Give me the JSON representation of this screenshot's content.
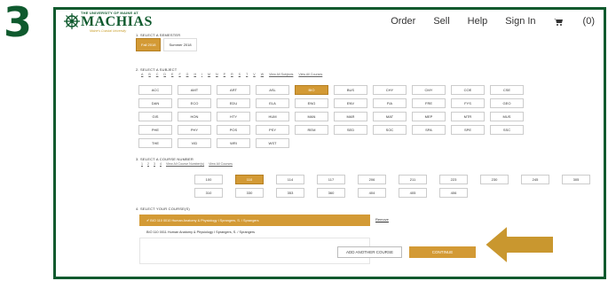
{
  "step_number": "3",
  "header": {
    "logo_top": "THE UNIVERSITY OF MAINE AT",
    "logo_main": "MACHIAS",
    "logo_sub": "Maine's Coastal University",
    "nav": [
      "Order",
      "Sell",
      "Help",
      "Sign In"
    ],
    "cart_count": "(0)"
  },
  "semester": {
    "label": "1. SELECT A SEMESTER",
    "options": [
      {
        "label": "Fall 2018",
        "active": true
      },
      {
        "label": "Summer 2018",
        "active": false
      }
    ]
  },
  "subject": {
    "label": "2. SELECT A SUBJECT",
    "letters": [
      "A",
      "B",
      "C",
      "D",
      "E",
      "F",
      "G",
      "H",
      "I",
      "M",
      "N",
      "P",
      "R",
      "S",
      "T",
      "V",
      "W"
    ],
    "view_all_subjects": "View All Subjects",
    "view_all_courses": "View All Courses",
    "items": [
      "ACC",
      "AMT",
      "ART",
      "ASL",
      "BIO",
      "BUS",
      "CHY",
      "CMY",
      "COE",
      "CSE",
      "DAN",
      "ECO",
      "EDU",
      "ELA",
      "ENG",
      "ENV",
      "FIA",
      "FRE",
      "FYS",
      "GEO",
      "GIS",
      "HON",
      "HTY",
      "HUM",
      "MAN",
      "MAR",
      "MAT",
      "MEP",
      "MTR",
      "MUS",
      "PHE",
      "PHY",
      "POS",
      "PSY",
      "REM",
      "SED",
      "SOC",
      "SPA",
      "SPE",
      "SSC",
      "THE",
      "VID",
      "WRI",
      "WST"
    ],
    "active": "BIO"
  },
  "course_number": {
    "label": "3. SELECT A COURSE NUMBER",
    "digits": [
      "1",
      "2",
      "3",
      "4"
    ],
    "view_all_numbers": "View All Course Number(s)",
    "view_all_courses": "View All Courses",
    "items": [
      "100",
      "110",
      "114",
      "117",
      "206",
      "211",
      "223",
      "230",
      "245",
      "305",
      "310",
      "330",
      "353",
      "360",
      "404",
      "405",
      "406"
    ],
    "active": "110"
  },
  "your_course": {
    "label": "4. SELECT YOUR COURSE(S)",
    "selected": "✔ BIO 110 0010  Human Anatomy & Physiology I Sprangers, S. / Sprangers",
    "other": "BIO 110 0011  Human Anatomy & Physiology I Sprangers, S. / Sprangers",
    "remove": "Remove"
  },
  "buttons": {
    "add_another": "ADD ANOTHER COURSE",
    "continue": "CONTINUE"
  },
  "colors": {
    "brand_green": "#0f5a2e",
    "accent_gold": "#d39a35"
  }
}
